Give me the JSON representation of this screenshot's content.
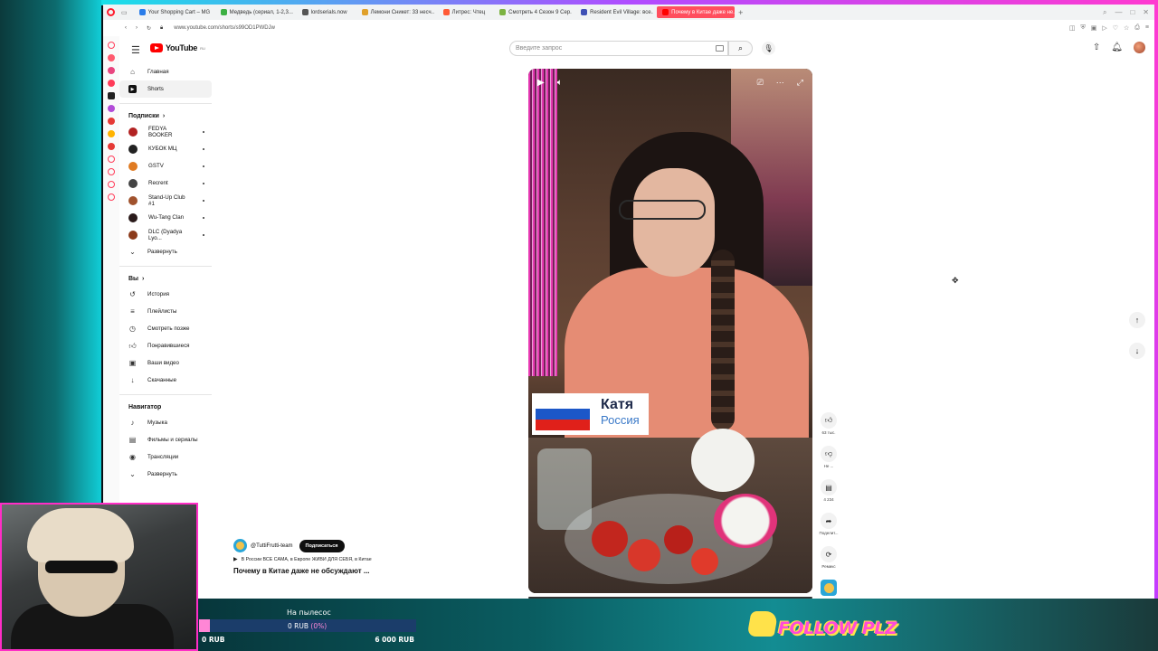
{
  "browser": {
    "tabs": [
      {
        "label": "Your Shopping Cart – MG",
        "color": "#2b7de9"
      },
      {
        "label": "Медведь (сериал, 1-2,3...",
        "color": "#3cb043"
      },
      {
        "label": "lordserials.now",
        "color": "#555555"
      },
      {
        "label": "Лемони Сникет: 33 несч...",
        "color": "#e0a12b"
      },
      {
        "label": "Литрес: Чтец",
        "color": "#ff5a36"
      },
      {
        "label": "Смотреть 4 Сезон 9 Сер...",
        "color": "#7cb342"
      },
      {
        "label": "Resident Evil Village: все...",
        "color": "#3f51b5"
      },
      {
        "label": "Почему в Китае даже не...",
        "color": "#ff0000"
      }
    ],
    "new_tab": "+",
    "url": "www.youtube.com/shorts/s99OD1PWDJw"
  },
  "youtube": {
    "logo_text": "YouTube",
    "logo_region": "RU",
    "search_placeholder": "Введите запрос",
    "sidebar": {
      "main": [
        {
          "label": "Главная",
          "icon": "home-icon"
        },
        {
          "label": "Shorts",
          "icon": "shorts-icon",
          "active": true
        }
      ],
      "subs_header": "Подписки",
      "subscriptions": [
        {
          "label": "FEDYA BOOKER",
          "color": "#b22222"
        },
        {
          "label": "КУБОК МЦ",
          "color": "#222222"
        },
        {
          "label": "GSTV",
          "color": "#e07b22"
        },
        {
          "label": "Recrent",
          "color": "#444444"
        },
        {
          "label": "Stand-Up Club #1",
          "color": "#a0522d"
        },
        {
          "label": "Wu-Tang Clan",
          "color": "#2a1a1a"
        },
        {
          "label": "DLC (Dyadya Lyo...",
          "color": "#8b3a1a"
        }
      ],
      "subs_expand": "Развернуть",
      "you_header": "Вы",
      "you": [
        {
          "label": "История",
          "icon": "history-icon"
        },
        {
          "label": "Плейлисты",
          "icon": "playlist-icon"
        },
        {
          "label": "Смотреть позже",
          "icon": "clock-icon"
        },
        {
          "label": "Понравившиеся",
          "icon": "thumb-up-icon"
        },
        {
          "label": "Ваши видео",
          "icon": "video-icon"
        },
        {
          "label": "Скачанные",
          "icon": "download-icon"
        }
      ],
      "nav_header": "Навигатор",
      "nav": [
        {
          "label": "Музыка",
          "icon": "music-icon"
        },
        {
          "label": "Фильмы и сериалы",
          "icon": "film-icon"
        },
        {
          "label": "Трансляции",
          "icon": "live-icon"
        },
        {
          "label": "Развернуть",
          "icon": "chevron-down-icon"
        }
      ]
    },
    "short": {
      "name_tag": "Катя",
      "country_tag": "Россия",
      "flag_colors": [
        "#ffffff",
        "#1c57c8",
        "#e0201a"
      ],
      "channel": "@TuttiFrutti-team",
      "subscribe_label": "Подписаться",
      "music": "В России ВСЕ САМА, в Европе ЖИВИ ДЛЯ СЕБЯ, в Китае",
      "title": "Почему в Китае даже не обсуждают ..."
    },
    "actions": {
      "likes": "63 тыс.",
      "dislike": "Не ...",
      "comments": "4 234",
      "share": "Поделит...",
      "remix": "Ремикс"
    }
  },
  "stream": {
    "donation_title": "На пылесос",
    "donation_current": "0 RUB",
    "donation_percent": "(0%)",
    "donation_progress": 0.05,
    "donation_min": "0 RUB",
    "donation_max": "6 000 RUB",
    "follow_text": "FOLLOW PLZ"
  }
}
